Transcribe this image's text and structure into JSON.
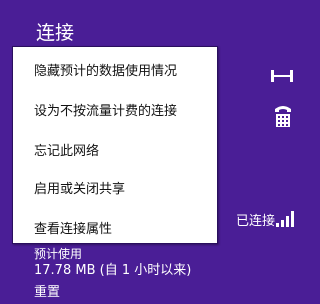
{
  "panel": {
    "title": "连接",
    "connection_status": "已连接",
    "data_usage_label": "预计使用",
    "data_usage_value": "17.78 MB (自 1 小时以来)",
    "reset_label": "重置",
    "background_color": "#4a1e96"
  },
  "context_menu": {
    "items": [
      {
        "label": "隐藏预计的数据使用情况"
      },
      {
        "label": "设为不按流量计费的连接"
      },
      {
        "label": "忘记此网络"
      },
      {
        "label": "启用或关闭共享"
      },
      {
        "label": "查看连接属性"
      }
    ]
  },
  "icons": {
    "ethernet": "ethernet-icon",
    "dialup": "dialup-phone-icon",
    "wifi_signal": "wifi-signal-icon"
  }
}
